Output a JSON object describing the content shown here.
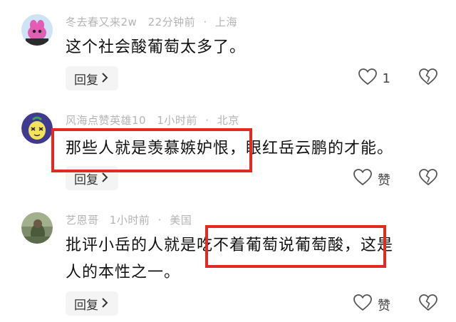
{
  "comments": [
    {
      "user": "冬去春又来2w",
      "time": "22分钟前",
      "location": "上海",
      "text_lines": [
        "这个社会酸葡萄太多了。"
      ],
      "reply_label": "回复",
      "like_count": "1"
    },
    {
      "user": "风海点赞英雄10",
      "time": "1小时前",
      "location": "北京",
      "text_lines": [
        "那些人就是羡慕嫉妒恨，眼红岳云鹏的才能。"
      ],
      "reply_label": "回复",
      "like_label": "赞"
    },
    {
      "user": "艺恩哥",
      "time": "1小时前",
      "location": "美国",
      "text_lines": [
        "批评小岳的人就是吃不着葡萄说葡萄酸，这是",
        "人的本性之一。"
      ],
      "reply_label": "回复",
      "like_label": "赞"
    }
  ],
  "colors": {
    "highlight_box": "#e02a22",
    "reply_bg": "#f4f4f4",
    "meta_text": "#b4b4b4"
  },
  "icons": [
    "heart-outline-icon",
    "broken-heart-icon",
    "chevron-right-icon"
  ]
}
